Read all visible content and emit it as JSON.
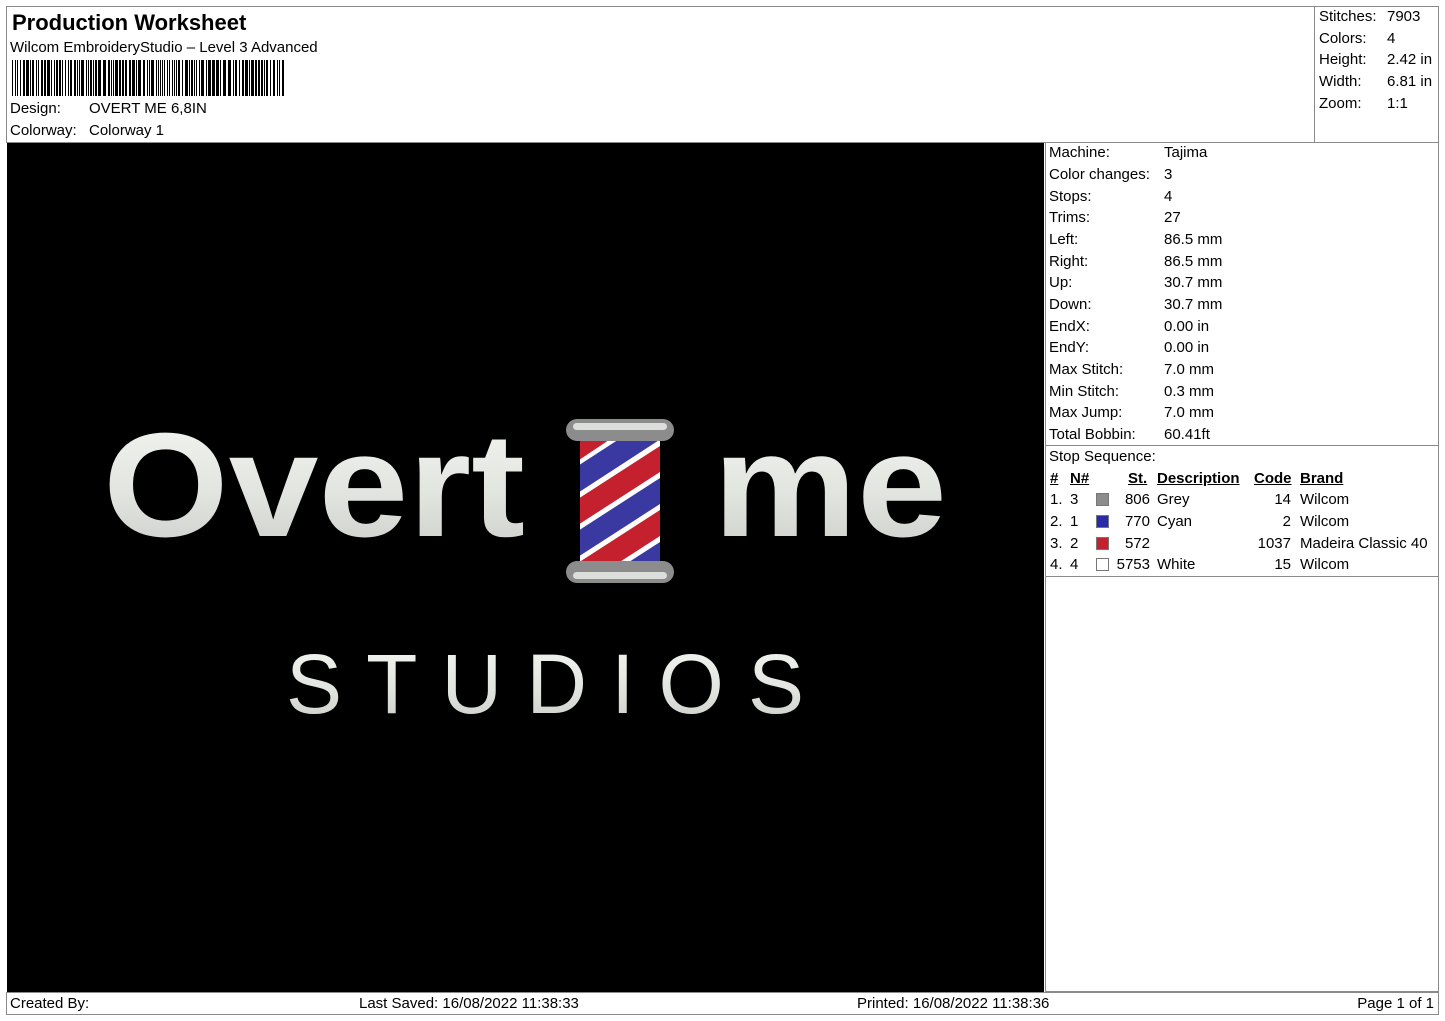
{
  "header": {
    "title": "Production Worksheet",
    "subtitle": "Wilcom EmbroideryStudio – Level 3 Advanced",
    "design_label": "Design:",
    "design_value": "OVERT ME 6,8IN",
    "colorway_label": "Colorway:",
    "colorway_value": "Colorway 1"
  },
  "summary": [
    {
      "label": "Stitches:",
      "value": "7903"
    },
    {
      "label": "Colors:",
      "value": "4"
    },
    {
      "label": "Height:",
      "value": "2.42 in"
    },
    {
      "label": "Width:",
      "value": "6.81 in"
    },
    {
      "label": "Zoom:",
      "value": "1:1"
    }
  ],
  "design_artwork": {
    "line1_left": "Overt",
    "line1_right": "me",
    "line2": "STUDIOS",
    "colors": {
      "background": "#000000",
      "thread_white": "#e8ebe6",
      "grey": "#8c8c8c",
      "red": "#c4202e",
      "blue": "#3a39a2"
    }
  },
  "machine_info": [
    {
      "label": "Machine:",
      "value": "Tajima"
    },
    {
      "label": "Color changes:",
      "value": "3"
    },
    {
      "label": "Stops:",
      "value": "4"
    },
    {
      "label": "Trims:",
      "value": "27"
    },
    {
      "label": "Left:",
      "value": "86.5 mm"
    },
    {
      "label": "Right:",
      "value": "86.5 mm"
    },
    {
      "label": "Up:",
      "value": "30.7 mm"
    },
    {
      "label": "Down:",
      "value": "30.7 mm"
    },
    {
      "label": "EndX:",
      "value": "0.00 in"
    },
    {
      "label": "EndY:",
      "value": "0.00 in"
    },
    {
      "label": "Max Stitch:",
      "value": "7.0 mm"
    },
    {
      "label": "Min Stitch:",
      "value": "0.3 mm"
    },
    {
      "label": "Max Jump:",
      "value": "7.0 mm"
    },
    {
      "label": "Total Bobbin:",
      "value": "60.41ft"
    }
  ],
  "stop_sequence": {
    "title": "Stop Sequence:",
    "headers": {
      "num": "#",
      "needle": "N#",
      "stitches": "St.",
      "description": "Description",
      "code": "Code",
      "brand": "Brand"
    },
    "rows": [
      {
        "index": "1.",
        "needle": "3",
        "color": "#8c8c8c",
        "stitches": "806",
        "description": "Grey",
        "code": "14",
        "brand": "Wilcom"
      },
      {
        "index": "2.",
        "needle": "1",
        "color": "#2b2ba8",
        "stitches": "770",
        "description": "Cyan",
        "code": "2",
        "brand": "Wilcom"
      },
      {
        "index": "3.",
        "needle": "2",
        "color": "#c4202e",
        "stitches": "572",
        "description": "",
        "code": "1037",
        "brand": "Madeira Classic 40"
      },
      {
        "index": "4.",
        "needle": "4",
        "color": "#ffffff",
        "stitches": "5753",
        "description": "White",
        "code": "15",
        "brand": "Wilcom"
      }
    ]
  },
  "footer": {
    "created_by": "Created By:",
    "last_saved": "Last Saved: 16/08/2022 11:38:33",
    "printed": "Printed: 16/08/2022 11:38:36",
    "page": "Page 1 of 1"
  }
}
